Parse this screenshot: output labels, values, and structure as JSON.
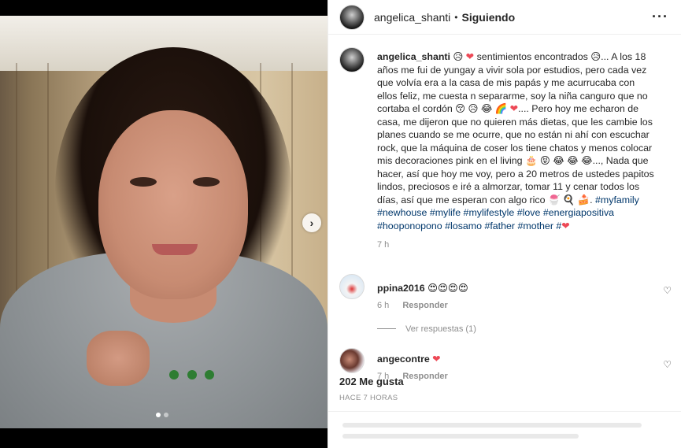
{
  "post": {
    "username": "angelica_shanti",
    "separator": "•",
    "follow_status": "Siguiendo",
    "more_icon": "more-dots-icon",
    "caption": {
      "username": "angelica_shanti",
      "segments": [
        {
          "t": "text",
          "v": " 😥 "
        },
        {
          "t": "heart",
          "v": "❤"
        },
        {
          "t": "text",
          "v": "  sentimientos encontrados 😥... A los 18 años me fui de yungay a vivir sola por estudios, pero cada vez que volvía era a la casa de mis papás y me acurrucaba con ellos feliz, me cuesta n separarme, soy la niña canguro que no cortaba el cordón 😚 😥 😂 🌈 "
        },
        {
          "t": "heart",
          "v": "❤"
        },
        {
          "t": "text",
          "v": ".... Pero hoy me echaron de casa, me dijeron que no quieren más dietas, que les cambie los planes cuando se me ocurre, que no están ni ahí con escuchar rock, que la máquina de coser los tiene chatos y menos colocar mis decoraciones pink en el living 🎂 😝 😂 😂 😂...,  Nada que hacer, así que hoy me voy, pero a 20 metros de ustedes papitos lindos, preciosos e iré a almorzar, tomar 11 y cenar todos los días, así que me esperan con algo rico 🍧 🍳 🍰. "
        },
        {
          "t": "tag",
          "v": "#myfamily"
        },
        {
          "t": "text",
          "v": " "
        },
        {
          "t": "tag",
          "v": "#newhouse"
        },
        {
          "t": "text",
          "v": " "
        },
        {
          "t": "tag",
          "v": "#mylife"
        },
        {
          "t": "text",
          "v": " "
        },
        {
          "t": "tag",
          "v": "#mylifestyle"
        },
        {
          "t": "text",
          "v": " "
        },
        {
          "t": "tag",
          "v": "#love"
        },
        {
          "t": "text",
          "v": " "
        },
        {
          "t": "tag",
          "v": "#energiapositiva"
        },
        {
          "t": "text",
          "v": " "
        },
        {
          "t": "tag",
          "v": "#hooponopono"
        },
        {
          "t": "text",
          "v": " "
        },
        {
          "t": "tag",
          "v": "#losamo"
        },
        {
          "t": "text",
          "v": " "
        },
        {
          "t": "tag",
          "v": "#father"
        },
        {
          "t": "text",
          "v": " "
        },
        {
          "t": "tag",
          "v": "#mother"
        },
        {
          "t": "text",
          "v": " "
        },
        {
          "t": "tag",
          "v": "#"
        },
        {
          "t": "heart",
          "v": "❤"
        }
      ],
      "time": "7 h"
    },
    "comments": [
      {
        "username": "ppina2016",
        "text": "😍😍😍😍",
        "time": "6 h",
        "reply_label": "Responder",
        "like_icon": "heart-outline-icon"
      },
      {
        "username": "angecontre",
        "text": "❤",
        "time": "7 h",
        "reply_label": "Responder",
        "like_icon": "heart-outline-icon"
      }
    ],
    "view_replies": "Ver respuestas (1)",
    "likes": "202 Me gusta",
    "posted_ago": "HACE 7 HORAS"
  },
  "carousel": {
    "next_icon": "chevron-right-icon",
    "total": 2,
    "active": 1
  },
  "colors": {
    "link": "#00376b",
    "heart": "#ed4956",
    "muted": "#8e8e8e",
    "text": "#262626"
  }
}
